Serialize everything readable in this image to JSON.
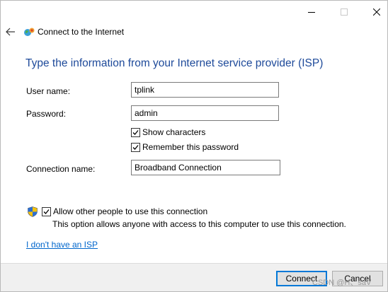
{
  "window": {
    "title": "Connect to the Internet"
  },
  "heading": "Type the information from your Internet service provider (ISP)",
  "form": {
    "username_label": "User name:",
    "username_value": "tplink",
    "password_label": "Password:",
    "password_value": "admin",
    "show_characters_label": "Show characters",
    "show_characters_checked": true,
    "remember_password_label": "Remember this password",
    "remember_password_checked": true,
    "connection_name_label": "Connection name:",
    "connection_name_value": "Broadband Connection"
  },
  "sharing": {
    "allow_label": "Allow other people to use this connection",
    "allow_checked": true,
    "description": "This option allows anyone with access to this computer to use this connection."
  },
  "link": {
    "no_isp": "I don't have an ISP"
  },
  "buttons": {
    "connect": "Connect",
    "cancel": "Cancel"
  },
  "watermark": "CSDN @H、saV",
  "colors": {
    "heading": "#1e4a9a",
    "link": "#0066cc",
    "default_button_border": "#0078d7",
    "footer_bg": "#f0f0f0"
  },
  "icons": {
    "back": "back-arrow-icon",
    "globe": "network-globe-icon",
    "shield": "uac-shield-icon",
    "minimize": "minimize-icon",
    "maximize": "maximize-icon",
    "close": "close-icon"
  }
}
